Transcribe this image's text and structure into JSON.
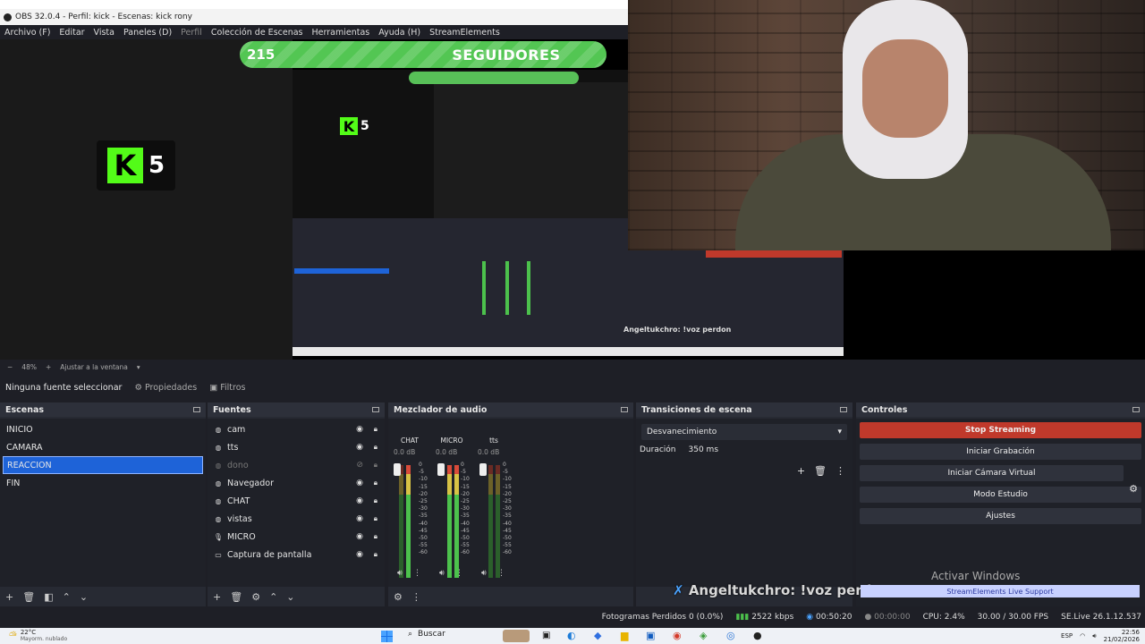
{
  "window": {
    "title": "OBS 32.0.4 - Perfil: kick - Escenas: kick rony"
  },
  "menu": [
    "Archivo (F)",
    "Editar",
    "Vista",
    "Paneles (D)",
    "Perfil",
    "Colección de Escenas",
    "Herramientas",
    "Ayuda (H)",
    "StreamElements"
  ],
  "overlay": {
    "followers_count": "215",
    "followers_label": "SEGUIDORES",
    "kick_count": "5"
  },
  "zoom": {
    "percent": "48%",
    "fit_label": "Ajustar a la ventana"
  },
  "properties_bar": {
    "no_source": "Ninguna fuente seleccionar",
    "properties": "Propiedades",
    "filters": "Filtros"
  },
  "scenes": {
    "title": "Escenas",
    "items": [
      {
        "label": "INICIO"
      },
      {
        "label": "CAMARA"
      },
      {
        "label": "REACCION"
      },
      {
        "label": "FIN"
      }
    ],
    "selected": "REACCION"
  },
  "sources": {
    "title": "Fuentes",
    "items": [
      {
        "label": "cam",
        "icon": "globe-icon"
      },
      {
        "label": "tts",
        "icon": "globe-icon"
      },
      {
        "label": "dono",
        "icon": "globe-icon",
        "hidden": true
      },
      {
        "label": "Navegador",
        "icon": "globe-icon"
      },
      {
        "label": "CHAT",
        "icon": "globe-icon"
      },
      {
        "label": "vistas",
        "icon": "globe-icon"
      },
      {
        "label": "MICRO",
        "icon": "microphone-icon"
      },
      {
        "label": "Captura de pantalla",
        "icon": "monitor-icon"
      }
    ]
  },
  "mixer": {
    "title": "Mezclador de audio",
    "channels": [
      {
        "name": "CHAT",
        "db": "0.0 dB"
      },
      {
        "name": "MICRO",
        "db": "0.0 dB"
      },
      {
        "name": "tts",
        "db": "0.0 dB"
      }
    ],
    "scale": [
      "0",
      "-5",
      "-10",
      "-15",
      "-20",
      "-25",
      "-30",
      "-35",
      "-40",
      "-45",
      "-50",
      "-55",
      "-60"
    ]
  },
  "transitions": {
    "title": "Transiciones de escena",
    "selected": "Desvanecimiento",
    "duration_label": "Duración",
    "duration_value": "350 ms"
  },
  "controls": {
    "title": "Controles",
    "stop_streaming": "Stop Streaming",
    "start_recording": "Iniciar Grabación",
    "virtual_camera": "Iniciar Cámara Virtual",
    "studio_mode": "Modo Estudio",
    "settings": "Ajustes"
  },
  "chat_overlay": "Angeltukchro: !voz perdon",
  "se_support": "StreamElements Live Support",
  "activate_windows": "Activar Windows",
  "status": {
    "dropped_frames": "Fotogramas Perdidos 0 (0.0%)",
    "bitrate": "2522 kbps",
    "live_time": "00:50:20",
    "rec_time": "00:00:00",
    "cpu": "CPU: 2.4%",
    "fps": "30.00 / 30.00 FPS",
    "se_version": "SE.Live 26.1.12.537"
  },
  "taskbar": {
    "weather": "22°C",
    "weather_sub": "Mayorm. nublado",
    "search": "Buscar",
    "time": "22:56",
    "lang": "ESP",
    "date": "21/02/2026"
  }
}
